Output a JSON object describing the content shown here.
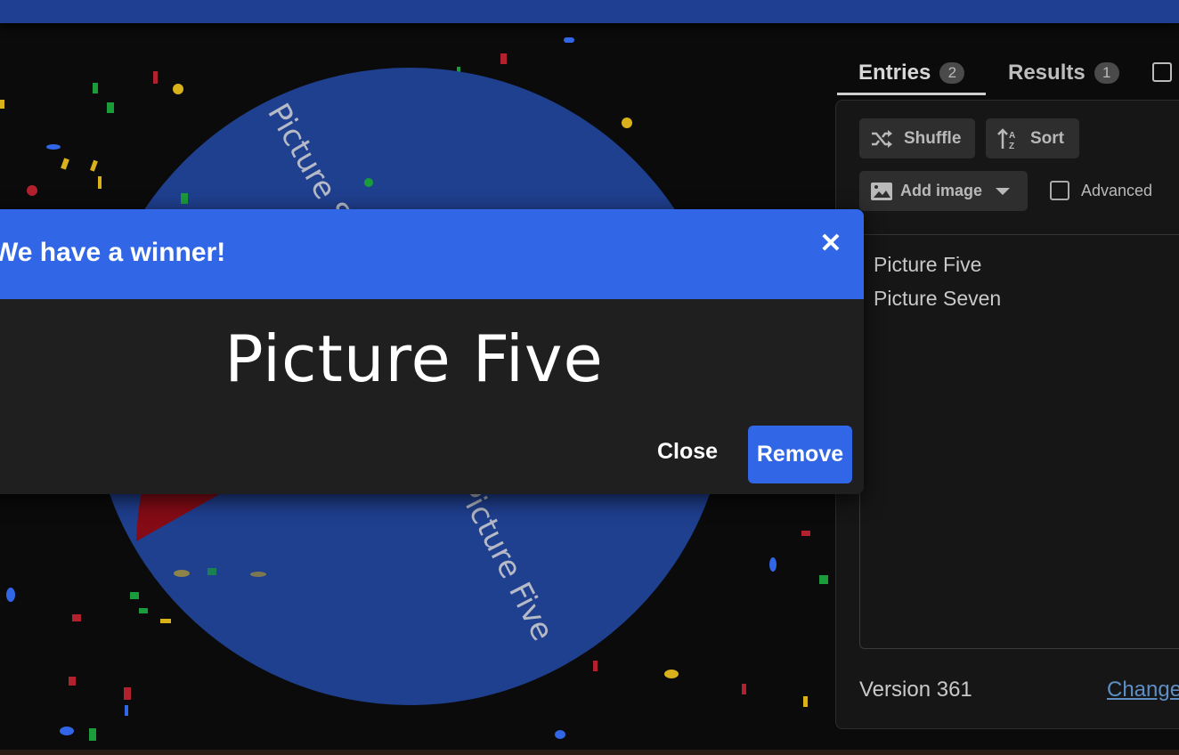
{
  "wheel": {
    "slices": [
      {
        "label": "Picture Seven",
        "color": "#850b16"
      },
      {
        "label": "Picture Five",
        "color": "#1f3f8f"
      }
    ]
  },
  "tabs": [
    {
      "label": "Entries",
      "count": "2"
    },
    {
      "label": "Results",
      "count": "1"
    }
  ],
  "toolbar": {
    "shuffle_label": "Shuffle",
    "sort_label": "Sort",
    "add_image_label": "Add image",
    "advanced_label": "Advanced"
  },
  "entries": [
    "Picture Five",
    "Picture Seven"
  ],
  "footer": {
    "version": "Version 361",
    "changelog_label": "Change"
  },
  "modal": {
    "title": "We have a winner!",
    "winner": "Picture Five",
    "close_label": "Close",
    "remove_label": "Remove"
  },
  "colors": {
    "accent": "#3167e6",
    "topbar": "#1f3f93"
  }
}
